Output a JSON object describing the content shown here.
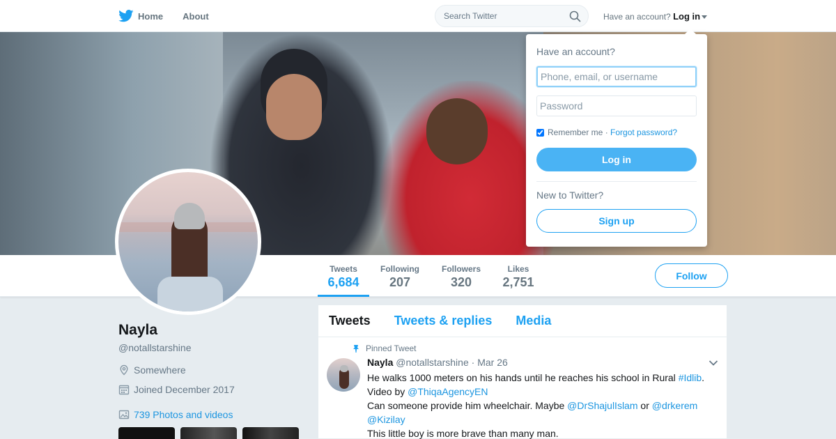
{
  "nav": {
    "home_label": "Home",
    "about_label": "About",
    "search_placeholder": "Search Twitter",
    "have_account_text": "Have an account?",
    "login_label": "Log in"
  },
  "profile": {
    "name": "Nayla",
    "handle": "@notallstarshine",
    "location": "Somewhere",
    "joined": "Joined December 2017",
    "photos_link": "739 Photos and videos"
  },
  "stats": [
    {
      "label": "Tweets",
      "value": "6,684",
      "active": true
    },
    {
      "label": "Following",
      "value": "207",
      "active": false
    },
    {
      "label": "Followers",
      "value": "320",
      "active": false
    },
    {
      "label": "Likes",
      "value": "2,751",
      "active": false
    }
  ],
  "follow_label": "Follow",
  "timeline": {
    "tabs": [
      "Tweets",
      "Tweets & replies",
      "Media"
    ],
    "pinned_label": "Pinned Tweet",
    "tweet": {
      "name": "Nayla",
      "handle": "@notallstarshine",
      "date": "· Mar 26",
      "line1": "He walks 1000 meters on his hands until he reaches his school in Rural ",
      "hashtag": "#Idlib",
      "line1_end": ".",
      "line2_prefix": "Video by ",
      "mention1": "@ThiqaAgencyEN",
      "line3_prefix": "Can someone provide him wheelchair. Maybe ",
      "mention2": "@DrShajulIslam",
      "or_text": " or ",
      "mention3": "@drkerem",
      "mention4": "@Kizilay",
      "line5": "This little boy is more brave than many man."
    }
  },
  "login_dropdown": {
    "title": "Have an account?",
    "username_placeholder": "Phone, email, or username",
    "password_placeholder": "Password",
    "remember_label": "Remember me",
    "sep": " · ",
    "forgot_label": "Forgot password?",
    "login_button": "Log in",
    "new_to_twitter": "New to Twitter?",
    "signup_button": "Sign up"
  },
  "colors": {
    "accent": "#1da1f2",
    "link": "#1b95e0",
    "login_button_bg": "#4ab3f4",
    "page_bg": "#e6ecf0"
  }
}
